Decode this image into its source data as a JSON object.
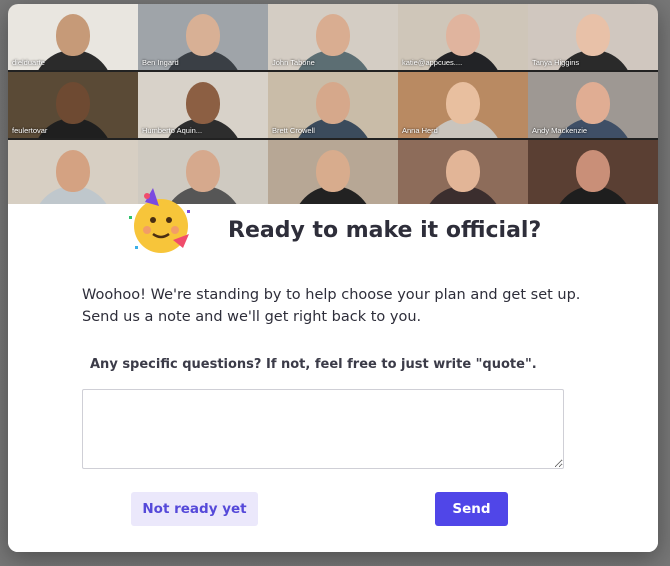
{
  "participants": [
    {
      "name": "dielduarte",
      "bg": "#e9e6e0",
      "skin": "#c69a78",
      "shirt": "#2b2b2b"
    },
    {
      "name": "Ben Ingard",
      "bg": "#9fa4a9",
      "skin": "#d8b095",
      "shirt": "#3a3f45"
    },
    {
      "name": "John Tabone",
      "bg": "#d4cdc4",
      "skin": "#d9ad91",
      "shirt": "#5c6e73"
    },
    {
      "name": "katie@appcues....",
      "bg": "#cfc6b9",
      "skin": "#e0b49e",
      "shirt": "#222326"
    },
    {
      "name": "Tanya Higgins",
      "bg": "#d0c7bf",
      "skin": "#e8c1a8",
      "shirt": "#2a2a2a"
    },
    {
      "name": "feulertovar",
      "bg": "#5a4a36",
      "skin": "#6e4a32",
      "shirt": "#1f1f1f"
    },
    {
      "name": "Humberto Aquin...",
      "bg": "#d8d2c9",
      "skin": "#8c5f43",
      "shirt": "#2d2d2d"
    },
    {
      "name": "Brett Crowell",
      "bg": "#c9bca8",
      "skin": "#d6a88b",
      "shirt": "#3b4b5c"
    },
    {
      "name": "Anna Herd",
      "bg": "#b98a62",
      "skin": "#e8bf9f",
      "shirt": "#c9c4bd"
    },
    {
      "name": "Andy Mackenzie",
      "bg": "#9e9893",
      "skin": "#e0ad93",
      "shirt": "#3f4f66"
    },
    {
      "name": "",
      "bg": "#d7cfc3",
      "skin": "#d4a282",
      "shirt": "#bfc7cc"
    },
    {
      "name": "",
      "bg": "#cfcac1",
      "skin": "#d6a98d",
      "shirt": "#565656"
    },
    {
      "name": "",
      "bg": "#b7a795",
      "skin": "#d8ac8d",
      "shirt": "#222222"
    },
    {
      "name": "",
      "bg": "#8d6c5a",
      "skin": "#e2b597",
      "shirt": "#3b2e2e"
    },
    {
      "name": "",
      "bg": "#5a3f33",
      "skin": "#c98f78",
      "shirt": "#1e1e1e"
    }
  ],
  "modal": {
    "icon": "party-face-emoji",
    "title": "Ready to make it official?",
    "description": "Woohoo! We're standing by to help choose your plan and get set up. Send us a note and we'll get right back to you.",
    "question_label": "Any specific questions? If not, feel free to just write \"quote\".",
    "textarea_value": "",
    "secondary_button": "Not ready yet",
    "primary_button": "Send"
  },
  "colors": {
    "primary": "#5046e8",
    "secondary_bg": "#ebe8fb",
    "secondary_text": "#5549d9",
    "title_text": "#2e2e3a"
  }
}
